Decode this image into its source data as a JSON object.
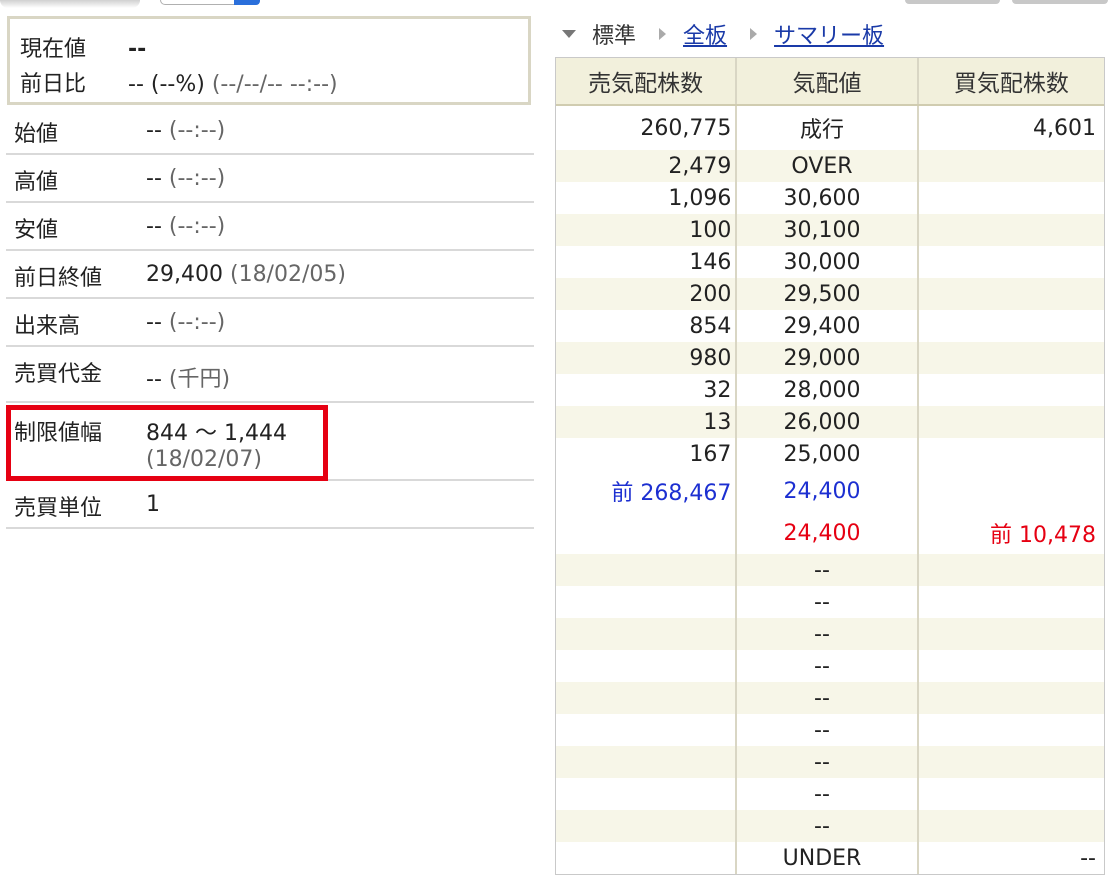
{
  "current": {
    "price_label": "現在値",
    "price_value": "--",
    "change_label": "前日比",
    "change_value": "-- (--%)",
    "change_time": "(--/--/-- --:--)"
  },
  "stats": [
    {
      "label": "始値",
      "value": "--",
      "note": "(--:--)"
    },
    {
      "label": "高値",
      "value": "--",
      "note": "(--:--)"
    },
    {
      "label": "安値",
      "value": "--",
      "note": "(--:--)"
    },
    {
      "label": "前日終値",
      "value": "29,400",
      "note": "(18/02/05)"
    },
    {
      "label": "出来高",
      "value": "--",
      "note": "(--:--)"
    },
    {
      "label": "売買代金",
      "value": "--",
      "note": "(千円)"
    },
    {
      "label": "制限値幅",
      "value": "844 〜 1,444",
      "note": "(18/02/07)"
    },
    {
      "label": "売買単位",
      "value": "1",
      "note": ""
    }
  ],
  "view": {
    "standard": "標準",
    "full_board": "全板",
    "summary_board": "サマリー板"
  },
  "board": {
    "headers": [
      "売気配株数",
      "気配値",
      "買気配株数"
    ],
    "rows": [
      {
        "sell": "260,775",
        "price": "成行",
        "buy": "4,601"
      },
      {
        "sell": "2,479",
        "price": "OVER",
        "buy": ""
      },
      {
        "sell": "1,096",
        "price": "30,600",
        "buy": ""
      },
      {
        "sell": "100",
        "price": "30,100",
        "buy": ""
      },
      {
        "sell": "146",
        "price": "30,000",
        "buy": ""
      },
      {
        "sell": "200",
        "price": "29,500",
        "buy": ""
      },
      {
        "sell": "854",
        "price": "29,400",
        "buy": ""
      },
      {
        "sell": "980",
        "price": "29,000",
        "buy": ""
      },
      {
        "sell": "32",
        "price": "28,000",
        "buy": ""
      },
      {
        "sell": "13",
        "price": "26,000",
        "buy": ""
      },
      {
        "sell": "167",
        "price": "25,000",
        "buy": ""
      },
      {
        "sell": "前 268,467",
        "price": "24,400",
        "buy": ""
      },
      {
        "sell": "",
        "price": "24,400",
        "buy": "前 10,478"
      },
      {
        "sell": "",
        "price": "--",
        "buy": ""
      },
      {
        "sell": "",
        "price": "--",
        "buy": ""
      },
      {
        "sell": "",
        "price": "--",
        "buy": ""
      },
      {
        "sell": "",
        "price": "--",
        "buy": ""
      },
      {
        "sell": "",
        "price": "--",
        "buy": ""
      },
      {
        "sell": "",
        "price": "--",
        "buy": ""
      },
      {
        "sell": "",
        "price": "--",
        "buy": ""
      },
      {
        "sell": "",
        "price": "--",
        "buy": ""
      },
      {
        "sell": "",
        "price": "--",
        "buy": ""
      },
      {
        "sell": "",
        "price": "UNDER",
        "buy": "--"
      }
    ]
  },
  "colors": {
    "highlight": "#e60012",
    "sell_prev": "#1c2fd1",
    "buy_prev": "#e60012",
    "header_bg": "#f2f0dc"
  }
}
